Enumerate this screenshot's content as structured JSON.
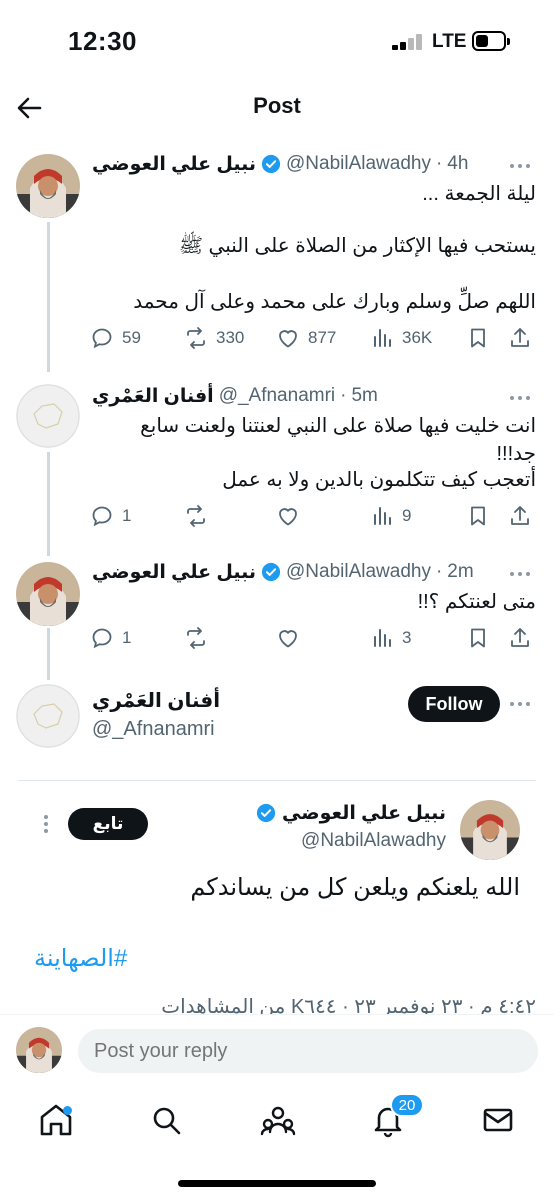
{
  "status_bar": {
    "time": "12:30",
    "network": "LTE"
  },
  "header": {
    "title": "Post"
  },
  "main_tweet": {
    "name": "نبيل علي العوضي",
    "handle": "@NabilAlawadhy",
    "time": "4h",
    "lines": [
      "ليلة الجمعة ...",
      "يستحب فيها الإكثار من الصلاة على النبي ﷺ",
      "اللهم صلِّ وسلم وبارك على محمد وعلى آل محمد"
    ],
    "replies": "59",
    "reposts": "330",
    "likes": "877",
    "views": "36K"
  },
  "reply1": {
    "name": "أفنان العَمْري",
    "handle": "@_Afnanamri",
    "time": "5m",
    "lines": [
      "انت خليت فيها صلاة على النبي لعنتنا ولعنت سابع",
      "جد!!!",
      "أتعجب كيف تتكلمون بالدين ولا به عمل"
    ],
    "replies": "1",
    "views": "9"
  },
  "reply2": {
    "name": "نبيل علي العوضي",
    "handle": "@NabilAlawadhy",
    "time": "2m",
    "text": "متى لعنتكم ؟!!",
    "replies": "1",
    "views": "3"
  },
  "follow_card": {
    "name": "أفنان العَمْري",
    "handle": "@_Afnanamri",
    "button": "Follow"
  },
  "quoted_post": {
    "name": "نبيل علي العوضي",
    "handle": "@NabilAlawadhy",
    "follow_button": "تابع",
    "text": "الله يلعنكم ويلعن كل من يساندكم",
    "hashtag": "#الصهاينة",
    "meta": "٤:٤٢ م · ٢٣ نوفمبر ٢٣ · K٦٤٤ من المشاهدات"
  },
  "reply_bar": {
    "placeholder": "Post your reply"
  },
  "tab_bar": {
    "notification_count": "20"
  },
  "colors": {
    "accent": "#1d9bf0",
    "text": "#0f1419",
    "muted": "#536471"
  }
}
